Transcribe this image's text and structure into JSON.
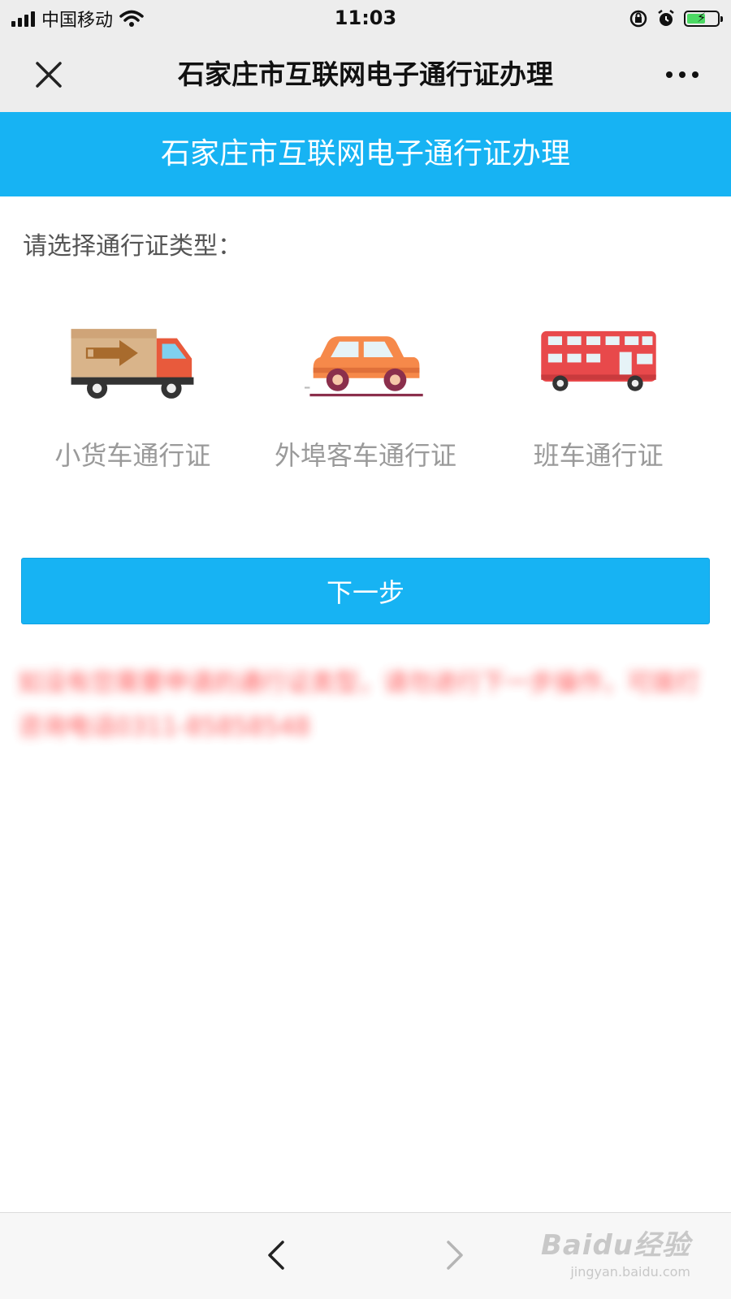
{
  "status_bar": {
    "carrier": "中国移动",
    "time": "11:03"
  },
  "nav": {
    "title": "石家庄市互联网电子通行证办理"
  },
  "header": {
    "title": "石家庄市互联网电子通行证办理"
  },
  "prompt": "请选择通行证类型：",
  "pass_types": [
    {
      "label": "小货车通行证",
      "icon": "truck-icon"
    },
    {
      "label": "外埠客车通行证",
      "icon": "car-icon"
    },
    {
      "label": "班车通行证",
      "icon": "bus-icon"
    }
  ],
  "next_button": "下一步",
  "notice": "如没有您需要申请的通行证类型，请勿进行下一步操作，可拨打咨询电话0311-85858548",
  "watermark": {
    "text": "Baidu经验",
    "sub": "jingyan.baidu.com"
  },
  "colors": {
    "accent": "#17b3f3",
    "nav_bg": "#ededed",
    "notice": "#ff3b3b"
  }
}
